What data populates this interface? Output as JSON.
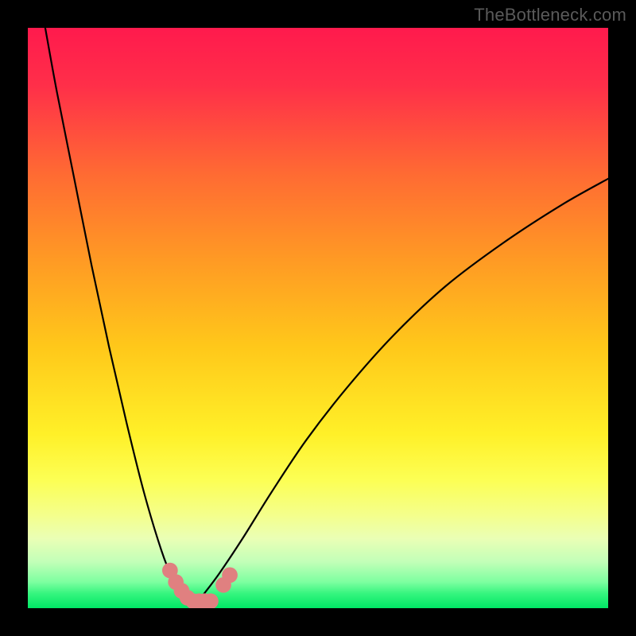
{
  "watermark": "TheBottleneck.com",
  "colors": {
    "bg": "#000000",
    "curve": "#000000",
    "marker": "#e08080",
    "gradient_stops": [
      {
        "offset": 0.0,
        "color": "#ff1a4d"
      },
      {
        "offset": 0.1,
        "color": "#ff2f49"
      },
      {
        "offset": 0.25,
        "color": "#ff6a33"
      },
      {
        "offset": 0.4,
        "color": "#ff9a24"
      },
      {
        "offset": 0.55,
        "color": "#ffc81a"
      },
      {
        "offset": 0.7,
        "color": "#fff028"
      },
      {
        "offset": 0.78,
        "color": "#fcff55"
      },
      {
        "offset": 0.84,
        "color": "#f4ff8c"
      },
      {
        "offset": 0.88,
        "color": "#eaffb5"
      },
      {
        "offset": 0.92,
        "color": "#c2ffb8"
      },
      {
        "offset": 0.955,
        "color": "#7dffa0"
      },
      {
        "offset": 0.975,
        "color": "#35f57e"
      },
      {
        "offset": 1.0,
        "color": "#00e765"
      }
    ]
  },
  "chart_data": {
    "type": "line",
    "title": "",
    "xlabel": "",
    "ylabel": "",
    "xlim": [
      0,
      100
    ],
    "ylim": [
      0,
      100
    ],
    "series": [
      {
        "name": "bottleneck-curve",
        "x": [
          3,
          5,
          8,
          11,
          14,
          17,
          20,
          23,
          25,
          27,
          28.5,
          30,
          33,
          37,
          42,
          48,
          55,
          63,
          72,
          82,
          92,
          100
        ],
        "values": [
          100,
          89,
          74,
          59,
          45,
          32,
          20,
          10,
          5,
          2,
          0,
          2,
          6,
          12,
          20,
          29,
          38,
          47,
          55.5,
          63,
          69.5,
          74
        ]
      }
    ],
    "markers": {
      "name": "highlight-cluster",
      "points": [
        {
          "x": 24.5,
          "y": 6.5
        },
        {
          "x": 25.5,
          "y": 4.5
        },
        {
          "x": 26.5,
          "y": 3.0
        },
        {
          "x": 27.5,
          "y": 1.8
        },
        {
          "x": 28.5,
          "y": 1.2
        },
        {
          "x": 29.5,
          "y": 1.2
        },
        {
          "x": 30.5,
          "y": 1.2
        },
        {
          "x": 31.5,
          "y": 1.2
        },
        {
          "x": 33.7,
          "y": 4.0
        },
        {
          "x": 34.8,
          "y": 5.7
        }
      ]
    }
  }
}
